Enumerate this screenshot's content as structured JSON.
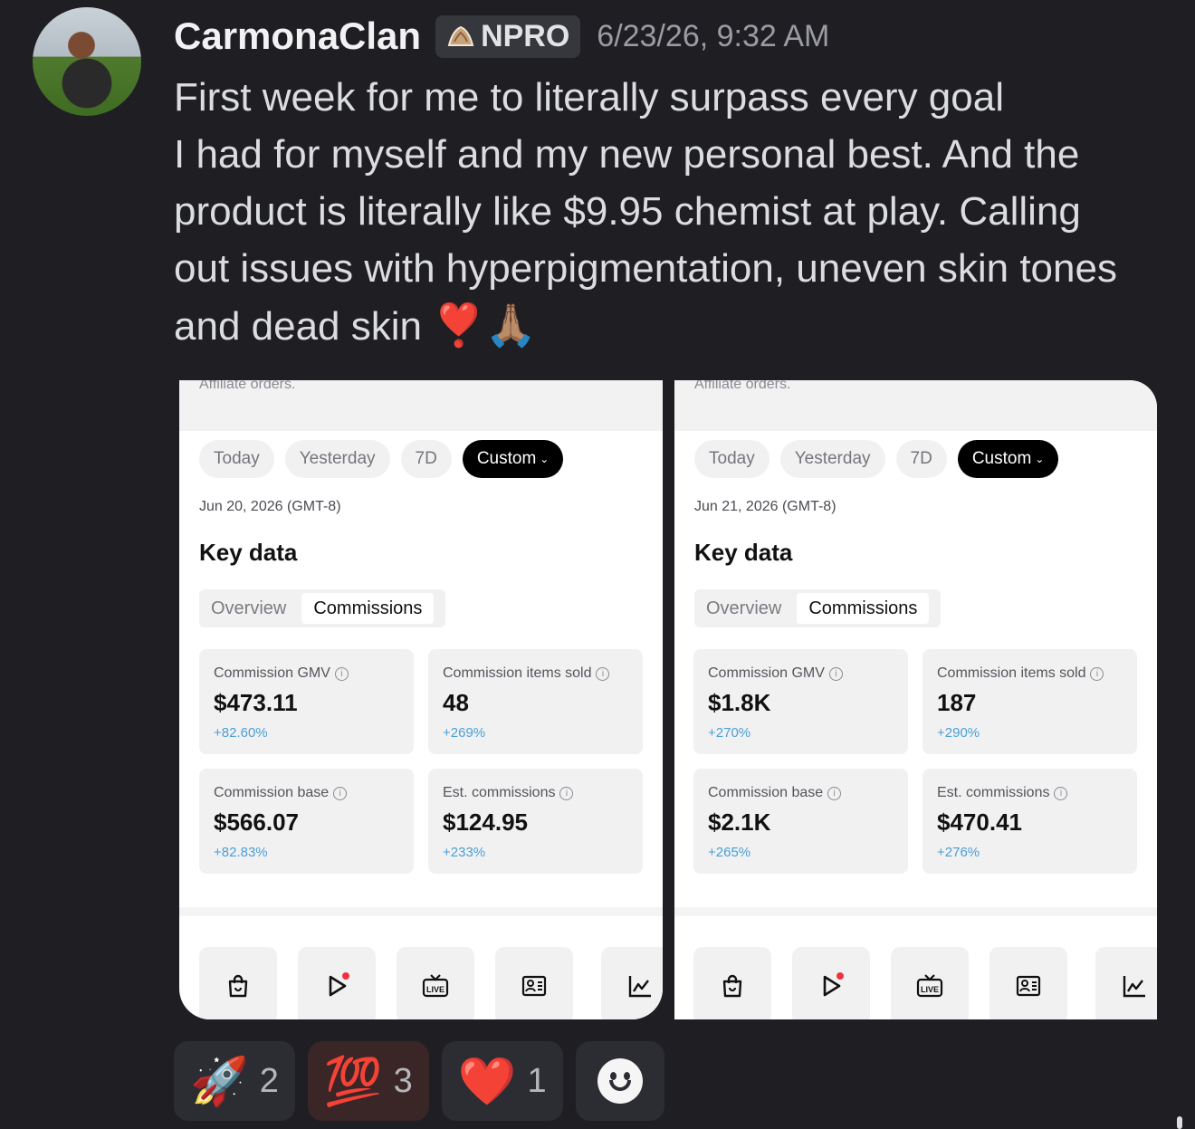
{
  "post": {
    "username": "CarmonaClan",
    "role": "NPRO",
    "timestamp": "6/23/26, 9:32 AM",
    "message_lines": [
      "First week for me to literally surpass every goal",
      "I had for myself and my new personal best. And the",
      "product is literally like $9.95 chemist at play. Calling",
      "out issues with hyperpigmentation, uneven skin tones",
      "and dead skin"
    ],
    "message_emoji": "❣️🙏🏽"
  },
  "screenshots": [
    {
      "header_text": "Affiliate orders.",
      "pills": [
        "Today",
        "Yesterday",
        "7D",
        "Custom"
      ],
      "date": "Jun 20, 2026 (GMT-8)",
      "key_data_title": "Key data",
      "tabs": [
        "Overview",
        "Commissions"
      ],
      "metrics": [
        {
          "label": "Commission GMV",
          "value": "$473.11",
          "change": "+82.60%"
        },
        {
          "label": "Commission items sold",
          "value": "48",
          "change": "+269%"
        },
        {
          "label": "Commission base",
          "value": "$566.07",
          "change": "+82.83%"
        },
        {
          "label": "Est. commissions",
          "value": "$124.95",
          "change": "+233%"
        }
      ]
    },
    {
      "header_text": "Affiliate orders.",
      "pills": [
        "Today",
        "Yesterday",
        "7D",
        "Custom"
      ],
      "date": "Jun 21, 2026 (GMT-8)",
      "key_data_title": "Key data",
      "tabs": [
        "Overview",
        "Commissions"
      ],
      "metrics": [
        {
          "label": "Commission GMV",
          "value": "$1.8K",
          "change": "+270%"
        },
        {
          "label": "Commission items sold",
          "value": "187",
          "change": "+290%"
        },
        {
          "label": "Commission base",
          "value": "$2.1K",
          "change": "+265%"
        },
        {
          "label": "Est. commissions",
          "value": "$470.41",
          "change": "+276%"
        }
      ]
    }
  ],
  "toolbar_icons": [
    "shopping-bag-icon",
    "play-icon",
    "live-icon",
    "id-card-icon",
    "chart-icon"
  ],
  "live_label": "LIVE",
  "reactions": [
    {
      "emoji": "🚀",
      "count": "2"
    },
    {
      "emoji": "💯",
      "count": "3"
    },
    {
      "emoji": "❤️",
      "count": "1"
    }
  ],
  "colors": {
    "background": "#1f1f23",
    "change_text": "#4b9fd6",
    "active_pill": "#000000"
  }
}
